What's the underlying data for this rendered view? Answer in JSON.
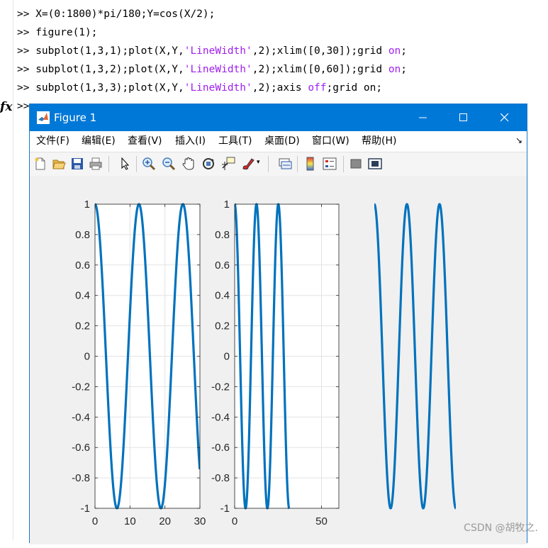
{
  "command_window": {
    "lines": [
      {
        "prompt": ">>",
        "pre": " X=(0:1800)*pi/180;Y=cos(X/2);",
        "kw1": "",
        "mid": "",
        "kw2": "",
        "post": ""
      },
      {
        "prompt": ">>",
        "pre": " figure(1);",
        "kw1": "",
        "mid": "",
        "kw2": "",
        "post": ""
      },
      {
        "prompt": ">>",
        "pre": " subplot(1,3,1);plot(X,Y,",
        "kw1": "'LineWidth'",
        "mid": ",2);xlim([0,30]);grid ",
        "kw2": "on",
        "post": ";"
      },
      {
        "prompt": ">>",
        "pre": " subplot(1,3,2);plot(X,Y,",
        "kw1": "'LineWidth'",
        "mid": ",2);xlim([0,60]);grid ",
        "kw2": "on",
        "post": ";"
      },
      {
        "prompt": ">>",
        "pre": " subplot(1,3,3);plot(X,Y,",
        "kw1": "'LineWidth'",
        "mid": ",2);axis ",
        "kw2": "off",
        "post": ";grid on;"
      }
    ],
    "last_prompt": ">>",
    "fx_label": "fx",
    "keyword_color": "#a020f0"
  },
  "figure_window": {
    "title": "Figure 1",
    "icon": "matlab-icon",
    "titlebar_color": "#0078d7",
    "controls": [
      "minimize-icon",
      "maximize-icon",
      "close-icon"
    ],
    "menu": [
      "文件(F)",
      "编辑(E)",
      "查看(V)",
      "插入(I)",
      "工具(T)",
      "桌面(D)",
      "窗口(W)",
      "帮助(H)"
    ],
    "dock_icon": "↘",
    "toolbar": [
      "new-figure-icon",
      "open-file-icon",
      "save-icon",
      "print-icon",
      "pointer-icon",
      "zoom-in-icon",
      "zoom-out-icon",
      "pan-icon",
      "rotate-3d-icon",
      "data-cursor-icon",
      "brush-icon",
      "link-plot-icon",
      "colorbar-icon",
      "legend-icon",
      "hide-plot-tools-icon",
      "show-plot-tools-icon"
    ]
  },
  "watermark": "CSDN @胡牧之.",
  "chart_data": [
    {
      "type": "line",
      "function": "y = cos(x/2)",
      "x_range_of_data": [
        0,
        31.4159
      ],
      "xlim": [
        0,
        30
      ],
      "ylim": [
        -1,
        1
      ],
      "xticks": [
        "0",
        "10",
        "20",
        "30"
      ],
      "yticks": [
        "-1",
        "-0.8",
        "-0.6",
        "-0.4",
        "-0.2",
        "0",
        "0.2",
        "0.4",
        "0.6",
        "0.8",
        "1"
      ],
      "grid": true,
      "line_color": "#0072bd",
      "line_width": 2
    },
    {
      "type": "line",
      "function": "y = cos(x/2)",
      "x_range_of_data": [
        0,
        31.4159
      ],
      "xlim": [
        0,
        60
      ],
      "ylim": [
        -1,
        1
      ],
      "xticks": [
        "0",
        "50"
      ],
      "yticks": [
        "-1",
        "-0.8",
        "-0.6",
        "-0.4",
        "-0.2",
        "0",
        "0.2",
        "0.4",
        "0.6",
        "0.8",
        "1"
      ],
      "grid": true,
      "line_color": "#0072bd",
      "line_width": 2
    },
    {
      "type": "line",
      "function": "y = cos(x/2)",
      "x_range_of_data": [
        0,
        31.4159
      ],
      "xlim": [
        0,
        31.4159
      ],
      "ylim": [
        -1,
        1
      ],
      "axis": "off",
      "grid": true,
      "line_color": "#0072bd",
      "line_width": 2
    }
  ]
}
